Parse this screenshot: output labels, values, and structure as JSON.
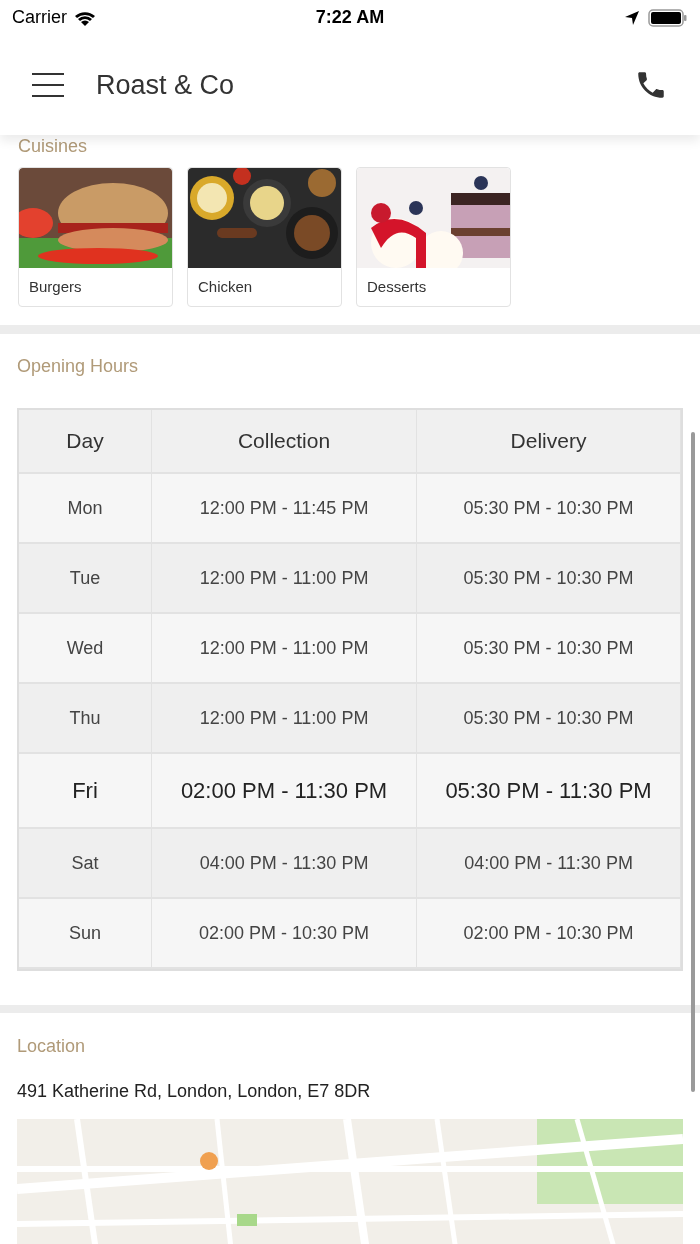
{
  "status_bar": {
    "carrier": "Carrier",
    "time": "7:22 AM"
  },
  "header": {
    "title": "Roast & Co"
  },
  "cuisines": {
    "title": "Cuisines",
    "items": [
      {
        "label": "Burgers",
        "kind": "burger"
      },
      {
        "label": "Chicken",
        "kind": "platter"
      },
      {
        "label": "Desserts",
        "kind": "cake"
      }
    ]
  },
  "opening_hours": {
    "title": "Opening Hours",
    "columns": [
      "Day",
      "Collection",
      "Delivery"
    ],
    "rows": [
      {
        "day": "Mon",
        "collection": "12:00 PM - 11:45 PM",
        "delivery": "05:30 PM - 10:30 PM",
        "today": false
      },
      {
        "day": "Tue",
        "collection": "12:00 PM - 11:00 PM",
        "delivery": "05:30 PM - 10:30 PM",
        "today": false
      },
      {
        "day": "Wed",
        "collection": "12:00 PM - 11:00 PM",
        "delivery": "05:30 PM - 10:30 PM",
        "today": false
      },
      {
        "day": "Thu",
        "collection": "12:00 PM - 11:00 PM",
        "delivery": "05:30 PM - 10:30 PM",
        "today": false
      },
      {
        "day": "Fri",
        "collection": "02:00 PM - 11:30 PM",
        "delivery": "05:30 PM - 11:30 PM",
        "today": true
      },
      {
        "day": "Sat",
        "collection": "04:00 PM - 11:30 PM",
        "delivery": "04:00 PM - 11:30 PM",
        "today": false
      },
      {
        "day": "Sun",
        "collection": "02:00 PM - 10:30 PM",
        "delivery": "02:00 PM - 10:30 PM",
        "today": false
      }
    ]
  },
  "location": {
    "title": "Location",
    "address": "491 Katherine Rd, London, London, E7 8DR"
  }
}
